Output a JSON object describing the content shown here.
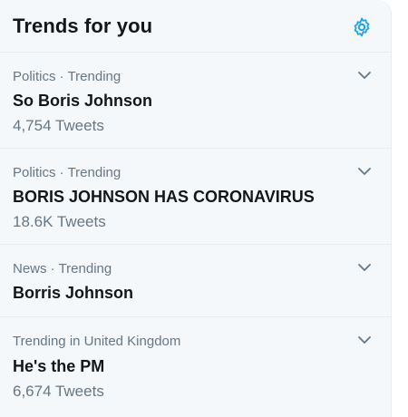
{
  "header": {
    "title": "Trends for you",
    "settings_icon": "gear-icon",
    "accent": "#1da1f2"
  },
  "trends": [
    {
      "meta": "Politics · Trending",
      "name": "So Boris Johnson",
      "count": "4,754 Tweets",
      "menu_icon": "chevron-down-icon"
    },
    {
      "meta": "Politics · Trending",
      "name": "BORIS JOHNSON HAS CORONAVIRUS",
      "count": "18.6K Tweets",
      "menu_icon": "chevron-down-icon"
    },
    {
      "meta": "News · Trending",
      "name": "Borris Johnson",
      "menu_icon": "chevron-down-icon"
    },
    {
      "meta": "Trending in United Kingdom",
      "name": "He's the PM",
      "count": "6,674 Tweets",
      "menu_icon": "chevron-down-icon"
    }
  ]
}
